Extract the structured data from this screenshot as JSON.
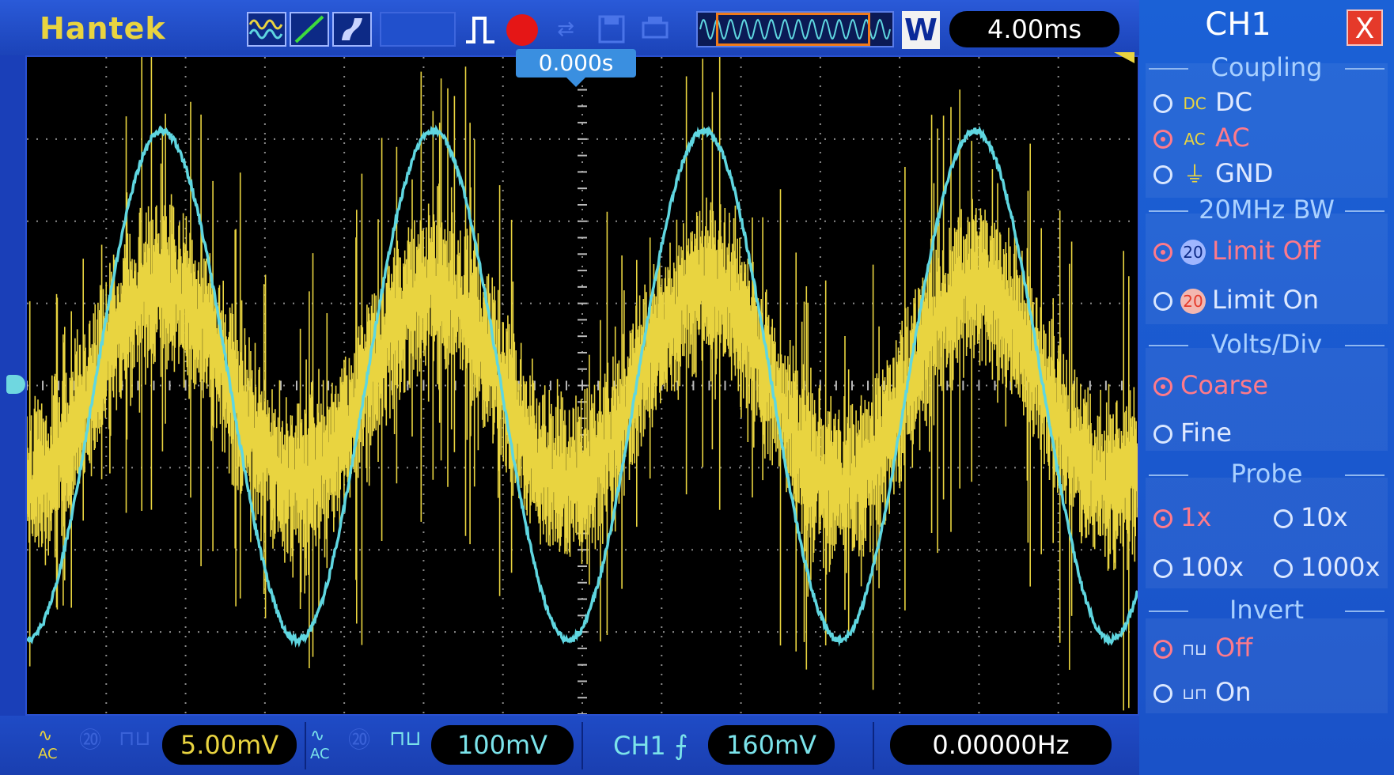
{
  "header": {
    "brand": "Hantek",
    "timebase": "4.00ms",
    "window_badge": "W",
    "trigger_position": "0.000s"
  },
  "footer": {
    "ch1_volts": "5.00mV",
    "ch2_volts": "100mV",
    "trigger_source": "CH1",
    "trigger_level": "160mV",
    "frequency": "0.00000Hz"
  },
  "menu": {
    "title": "CH1",
    "close": "X",
    "coupling": {
      "label": "Coupling",
      "options": [
        {
          "label": "DC",
          "icon": "DC"
        },
        {
          "label": "AC",
          "icon": "AC"
        },
        {
          "label": "GND",
          "icon": "ground"
        }
      ],
      "selected": "AC"
    },
    "bandwidth": {
      "label": "20MHz BW",
      "options": [
        {
          "label": "Limit Off",
          "icon": "20"
        },
        {
          "label": "Limit On",
          "icon": "20"
        }
      ],
      "selected": "Limit Off"
    },
    "volts_div": {
      "label": "Volts/Div",
      "options": [
        "Coarse",
        "Fine"
      ],
      "selected": "Coarse"
    },
    "probe": {
      "label": "Probe",
      "options": [
        "1x",
        "10x",
        "100x",
        "1000x"
      ],
      "selected": "1x"
    },
    "invert": {
      "label": "Invert",
      "options": [
        "Off",
        "On"
      ],
      "selected": "Off"
    }
  },
  "colors": {
    "ch1": "#e9d440",
    "ch2": "#5fd6e0",
    "active_option": "#ff7a8a",
    "frame": "#1a3fb8"
  },
  "chart_data": {
    "type": "line",
    "x_divisions": 14,
    "y_divisions": 8,
    "series": [
      {
        "color": "#5fd6e0",
        "shape": "sine",
        "cycles": 4.1,
        "amplitude_div": 3.1
      },
      {
        "color": "#e9d440",
        "shape": "noisy-sine",
        "cycles": 4.1,
        "amplitude_div": 1.2
      }
    ]
  }
}
